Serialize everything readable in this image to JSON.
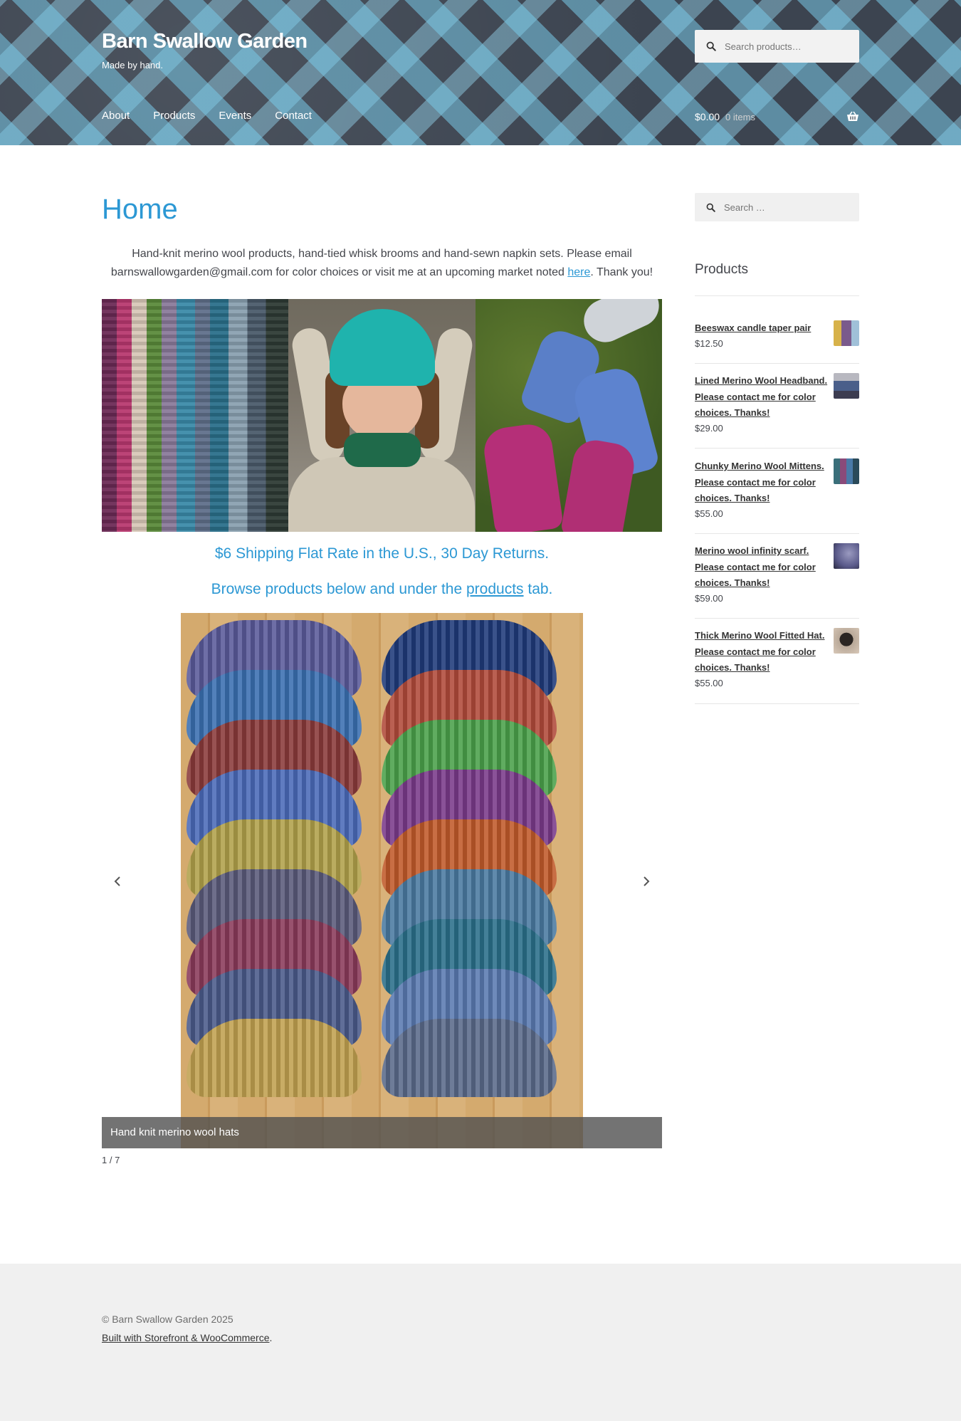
{
  "header": {
    "site_title": "Barn Swallow Garden",
    "tagline": "Made by hand.",
    "search_placeholder": "Search products…",
    "nav": [
      "About",
      "Products",
      "Events",
      "Contact"
    ],
    "cart_total": "$0.00",
    "cart_items": "0 items"
  },
  "main": {
    "page_title": "Home",
    "intro_text": "Hand-knit merino wool products, hand-tied whisk brooms and hand-sewn napkin sets. Please email barnswallowgarden@gmail.com for color choices or visit me at an upcoming market noted ",
    "intro_link": "here",
    "intro_end": ". Thank you!",
    "shipping": "$6 Shipping Flat Rate in the U.S., 30 Day Returns.",
    "browse_pre": "Browse products below and under the ",
    "browse_link": "products",
    "browse_post": " tab.",
    "slider": {
      "caption": "Hand knit merino wool hats",
      "counter": "1 / 7",
      "prev_icon": "chevron-left-icon",
      "next_icon": "chevron-right-icon"
    }
  },
  "sidebar": {
    "search_placeholder": "Search …",
    "heading": "Products",
    "products": [
      {
        "name": "Beeswax candle taper pair",
        "price": "$12.50",
        "thumb_color": "#7a5a8c"
      },
      {
        "name": "Lined Merino Wool Headband. Please contact me for color choices. Thanks!",
        "price": "$29.00",
        "thumb_color": "#4a5f8a"
      },
      {
        "name": "Chunky Merino Wool Mittens. Please contact me for color choices. Thanks!",
        "price": "$55.00",
        "thumb_color": "#3a6f7a"
      },
      {
        "name": "Merino wool infinity scarf. Please contact me for color choices. Thanks!",
        "price": "$59.00",
        "thumb_color": "#5a5a8a"
      },
      {
        "name": "Thick Merino Wool Fitted Hat. Please contact me for color choices. Thanks!",
        "price": "$55.00",
        "thumb_color": "#3a2f2a"
      }
    ]
  },
  "footer": {
    "copyright": "© Barn Swallow Garden 2025",
    "credit_link": "Built with Storefront & WooCommerce",
    "credit_end": "."
  },
  "colors": {
    "accent": "#2c98d4",
    "text": "#43454b",
    "footer_bg": "#f0f0f0"
  }
}
